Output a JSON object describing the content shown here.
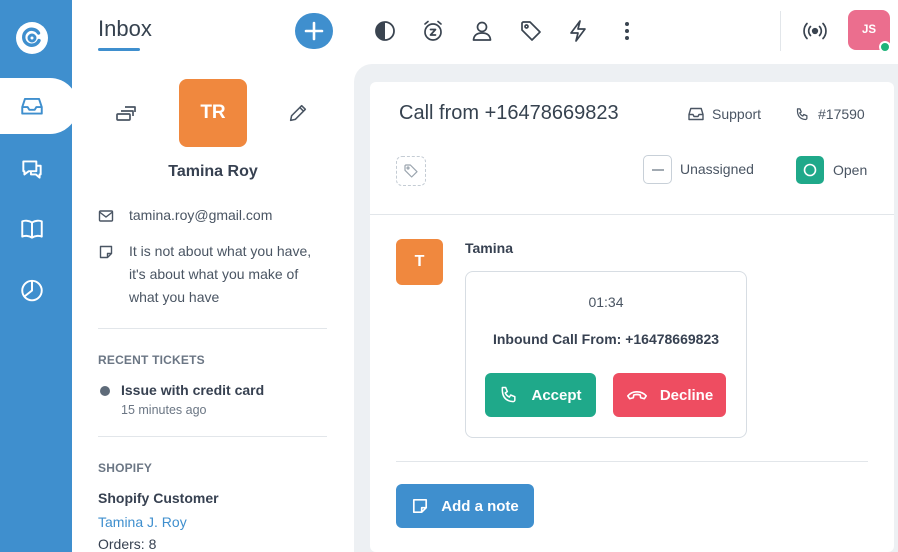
{
  "app": {
    "icons": [
      "logo-icon",
      "inbox-icon",
      "chat-icon",
      "book-icon",
      "reports-icon"
    ],
    "accent_color": "#3f8fce"
  },
  "sidebar": {
    "title": "Inbox",
    "contact": {
      "initials": "TR",
      "name": "Tamina Roy",
      "email": "tamina.roy@gmail.com",
      "note": "It is not about what you have, it's about what you make of what you have",
      "avatar_color": "#f0883e"
    },
    "recent_tickets": {
      "label": "RECENT TICKETS",
      "items": [
        {
          "title": "Issue with credit card",
          "time": "15 minutes ago"
        }
      ]
    },
    "shopify": {
      "label": "SHOPIFY",
      "customer_label": "Shopify Customer",
      "customer_name": "Tamina J. Roy",
      "orders": "Orders: 8"
    }
  },
  "topbar": {
    "icons": [
      "contrast-icon",
      "snooze-icon",
      "user-icon",
      "tag-icon",
      "lightning-icon",
      "more-vertical-icon",
      "broadcast-icon"
    ],
    "user_initials": "JS",
    "user_color": "#eb6e8e",
    "status_color": "#1fb37a"
  },
  "conversation": {
    "title": "Call from +16478669823",
    "channel": "Support",
    "ticket_id": "#17590",
    "assignee": "Unassigned",
    "status": "Open",
    "message": {
      "sender_initial": "T",
      "sender_name": "Tamina",
      "timer": "01:34",
      "inbound_text": "Inbound Call From: +16478669823",
      "accept_label": "Accept",
      "decline_label": "Decline"
    },
    "add_note_label": "Add a note",
    "colors": {
      "accept": "#1fa98a",
      "decline": "#ee4d61",
      "open": "#1fa98a"
    }
  }
}
